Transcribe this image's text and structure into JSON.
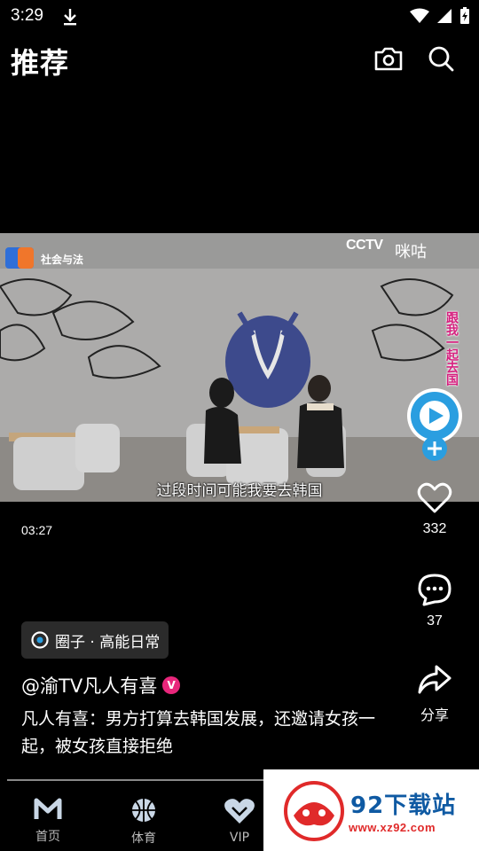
{
  "status": {
    "time": "3:29"
  },
  "header": {
    "title": "推荐"
  },
  "video": {
    "channel": "社会与法",
    "broadcaster": "CCTV",
    "broadcaster_partner": "咪咕",
    "subtitle": "过段时间可能我要去韩国",
    "overlay_text": "跟我一起去国",
    "duration": "03:27"
  },
  "actions": {
    "likes": "332",
    "comments": "37",
    "share_label": "分享"
  },
  "circle": {
    "label": "圈子 · 高能日常"
  },
  "author": {
    "name": "@渝TV凡人有喜",
    "verified_mark": "V"
  },
  "description": "凡人有喜：男方打算去韩国发展，还邀请女孩一起，被女孩直接拒绝",
  "nav": {
    "items": [
      {
        "label": "首页",
        "icon": "home-logo-icon"
      },
      {
        "label": "体育",
        "icon": "basketball-icon"
      },
      {
        "label": "VIP",
        "icon": "vip-heart-icon"
      }
    ]
  },
  "watermark": {
    "name": "92下载站",
    "url": "www.xz92.com"
  },
  "colors": {
    "background": "#000000",
    "accent_pink": "#e8267b",
    "watermark_blue": "#0f5aa3",
    "watermark_red": "#e02a2a"
  }
}
